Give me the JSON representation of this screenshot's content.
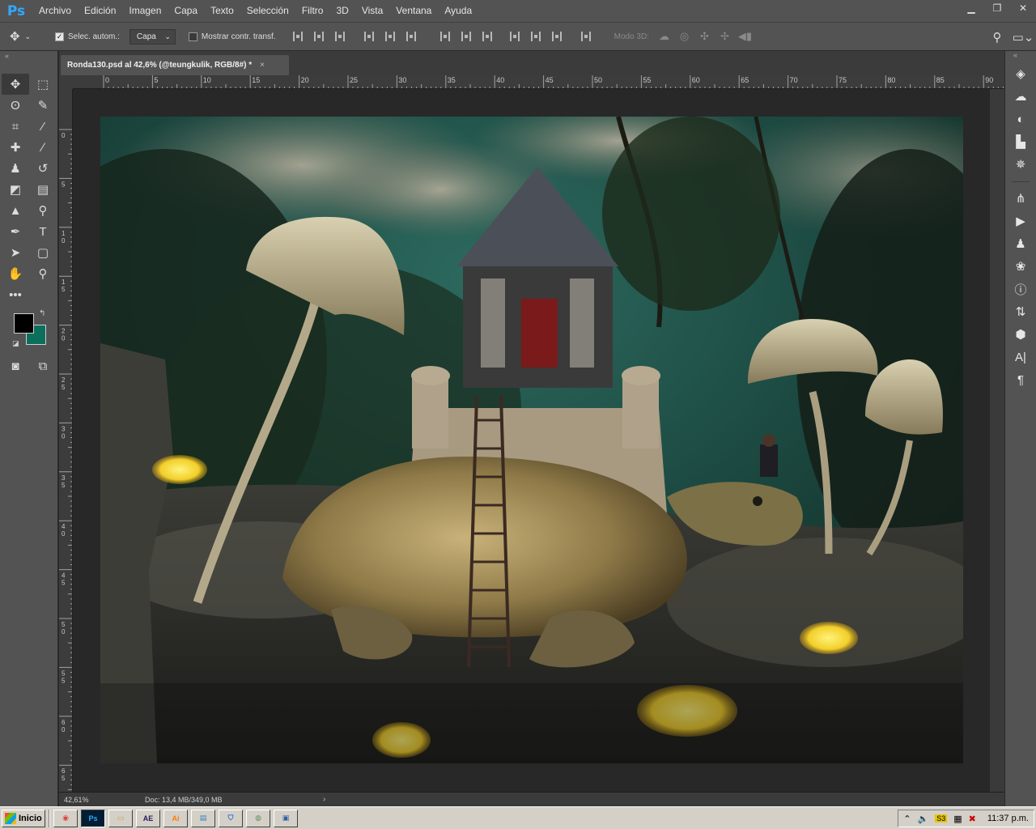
{
  "app": {
    "logo": "Ps",
    "menu": [
      "Archivo",
      "Edición",
      "Imagen",
      "Capa",
      "Texto",
      "Selección",
      "Filtro",
      "3D",
      "Vista",
      "Ventana",
      "Ayuda"
    ]
  },
  "options": {
    "auto_select_label": "Selec. autom.:",
    "auto_select_checked": true,
    "auto_select_target": "Capa",
    "show_transform_label": "Mostrar contr. transf.",
    "show_transform_checked": false,
    "mode_3d_label": "Modo 3D:"
  },
  "document": {
    "tab_title": "Ronda130.psd al 42,6% (@teungkulik, RGB/8#) *",
    "close_glyph": "×",
    "ruler_h": [
      "0",
      "5",
      "10",
      "15",
      "20",
      "25",
      "30",
      "35",
      "40",
      "45",
      "50",
      "55",
      "60",
      "65",
      "70",
      "75",
      "80",
      "85",
      "90"
    ],
    "ruler_v": [
      "0",
      "5",
      "1\n0",
      "1\n5",
      "2\n0",
      "2\n5",
      "3\n0",
      "3\n5",
      "4\n0",
      "4\n5",
      "5\n0",
      "5\n5",
      "6\n0",
      "6\n5"
    ]
  },
  "status": {
    "zoom": "42,61%",
    "doc_size": "Doc: 13,4 MB/349,0 MB",
    "arrow": "›"
  },
  "colors": {
    "foreground": "#000000",
    "background": "#0c6f5c",
    "accent": "#31a8ff"
  },
  "tools": [
    "move-tool-icon",
    "marquee-tool-icon",
    "lasso-tool-icon",
    "quick-selection-tool-icon",
    "crop-tool-icon",
    "eyedropper-tool-icon",
    "healing-brush-tool-icon",
    "brush-tool-icon",
    "clone-stamp-tool-icon",
    "history-brush-tool-icon",
    "eraser-tool-icon",
    "gradient-tool-icon",
    "blur-tool-icon",
    "dodge-tool-icon",
    "pen-tool-icon",
    "type-tool-icon",
    "path-selection-tool-icon",
    "shape-tool-icon",
    "hand-tool-icon",
    "zoom-tool-icon",
    "more-tools-icon"
  ],
  "right_panel": [
    "layers-icon",
    "libraries-icon",
    "adjustments-icon",
    "histogram-icon",
    "navigator-icon",
    "paths-icon",
    "actions-icon",
    "clone-source-icon",
    "color-icon",
    "info-icon",
    "history-icon",
    "3d-icon",
    "character-icon",
    "paragraph-icon"
  ],
  "taskbar": {
    "start_label": "Inicio",
    "apps": [
      "chrome",
      "Ps",
      "explorer",
      "AE",
      "Ai",
      "notepad",
      "shield",
      "paint",
      "window"
    ],
    "clock": "11:37 p.m."
  }
}
